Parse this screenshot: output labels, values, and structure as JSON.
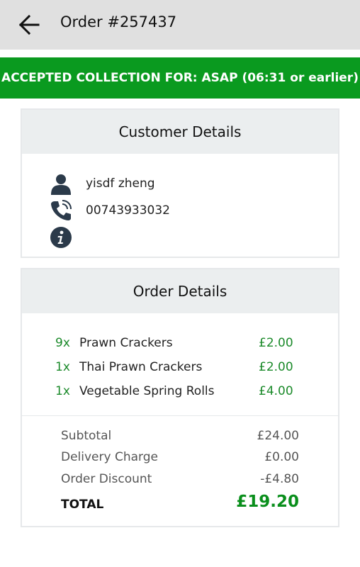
{
  "header": {
    "title": "Order #257437",
    "back_icon": "arrow-left-icon"
  },
  "banner": {
    "text": "ACCEPTED COLLECTION FOR: ASAP (06:31 or earlier)",
    "color": "#0a9a1f"
  },
  "customer": {
    "heading": "Customer Details",
    "name": "yisdf zheng",
    "phone": "00743933032",
    "icons": [
      "person-icon",
      "phone-icon",
      "info-icon"
    ]
  },
  "order": {
    "heading": "Order Details",
    "items": [
      {
        "qty": "9x",
        "name": "Prawn Crackers",
        "price": "£2.00"
      },
      {
        "qty": "1x",
        "name": "Thai Prawn Crackers",
        "price": "£2.00"
      },
      {
        "qty": "1x",
        "name": "Vegetable Spring Rolls",
        "price": "£4.00"
      }
    ],
    "summary": [
      {
        "label": "Subtotal",
        "value": "£24.00"
      },
      {
        "label": "Delivery Charge",
        "value": "£0.00"
      },
      {
        "label": "Order Discount",
        "value": "-£4.80"
      }
    ],
    "total_label": "TOTAL",
    "total_value": "£19.20"
  },
  "colors": {
    "accent_green": "#0a9a1f",
    "header_bg": "#e0e0e0",
    "icon_dark": "#2b3a4a"
  }
}
